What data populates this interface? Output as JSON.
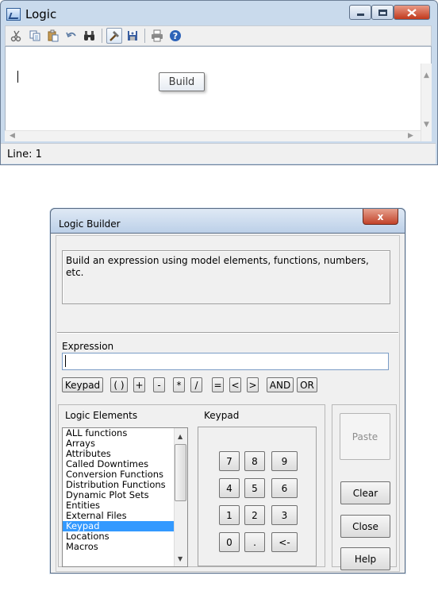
{
  "logic_window": {
    "title": "Logic",
    "tooltip": "Build",
    "status": "Line: 1",
    "toolbar_icons": [
      "cut-icon",
      "copy-icon",
      "paste-icon",
      "undo-icon",
      "find-icon",
      "build-icon",
      "save-icon",
      "print-icon",
      "help-icon"
    ]
  },
  "builder": {
    "title": "Logic Builder",
    "close_glyph": "x",
    "description": "Build an expression using model elements, functions, numbers, etc.",
    "expression_label": "Expression",
    "expression_value": "",
    "operators": [
      "Keypad",
      "( )",
      "+",
      "-",
      "*",
      "/",
      "=",
      "<",
      ">",
      "AND",
      "OR"
    ],
    "logic_elements_label": "Logic Elements",
    "keypad_label": "Keypad",
    "elements": [
      "ALL functions",
      "Arrays",
      "Attributes",
      "Called Downtimes",
      "Conversion Functions",
      "Distribution Functions",
      "Dynamic Plot Sets",
      "Entities",
      "External Files",
      "Keypad",
      "Locations",
      "Macros"
    ],
    "selected_element": "Keypad",
    "keypad_keys": [
      "7",
      "8",
      "9",
      "4",
      "5",
      "6",
      "1",
      "2",
      "3",
      "0",
      ".",
      "<-"
    ],
    "buttons": {
      "paste": "Paste",
      "clear": "Clear",
      "close": "Close",
      "help": "Help"
    }
  }
}
